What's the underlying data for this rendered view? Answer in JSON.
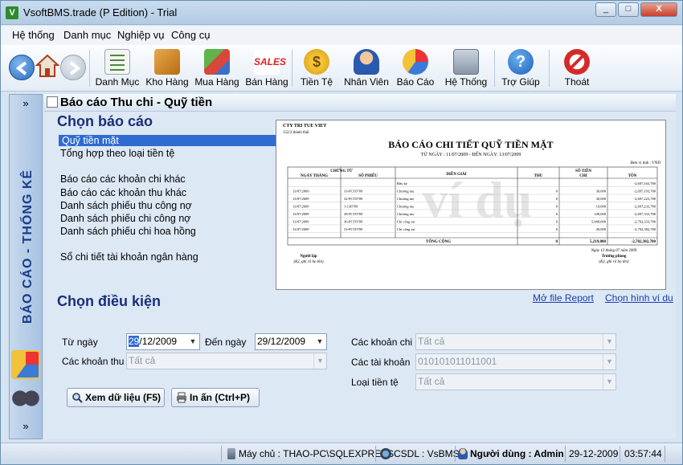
{
  "window": {
    "title": "VsoftBMS.trade (P Edition) - Trial",
    "min": "_",
    "max": "□",
    "close": "X"
  },
  "menu": [
    "Hệ thống",
    "Danh mục",
    "Nghiệp vụ",
    "Công cụ"
  ],
  "toolbar": {
    "items": [
      {
        "label": "Danh Mục",
        "icon": "list-icon"
      },
      {
        "label": "Kho Hàng",
        "icon": "box-icon"
      },
      {
        "label": "Mua Hàng",
        "icon": "purchase-icon"
      },
      {
        "label": "Bán Hàng",
        "icon": "sales-icon"
      },
      {
        "label": "Tiền Tệ",
        "icon": "money-icon"
      },
      {
        "label": "Nhân Viên",
        "icon": "person-icon"
      },
      {
        "label": "Báo Cáo",
        "icon": "chart-icon"
      },
      {
        "label": "Hệ Thống",
        "icon": "network-icon"
      },
      {
        "label": "Trợ Giúp",
        "icon": "help-icon"
      },
      {
        "label": "Thoát",
        "icon": "exit-icon"
      }
    ]
  },
  "sidebar": {
    "collapse": "»",
    "vertical_label": "BÁO CÁO - THỐNG KÊ",
    "expand": "»"
  },
  "panel": {
    "title": "Báo cáo Thu chi - Quỹ tiền"
  },
  "choose_report": {
    "heading": "Chọn báo cáo",
    "items": [
      "Quỹ tiền mặt",
      "Tổng hợp theo loại tiền tệ",
      "Báo cáo các khoản chi khác",
      "Báo cáo các khoản thu khác",
      "Danh sách phiếu thu công nợ",
      "Danh sách phiếu chi công nợ",
      "Danh sách phiếu chi hoa hồng",
      "Sổ chi tiết tài khoản ngân hàng"
    ]
  },
  "preview": {
    "company": "CTY TRI TUE VIET",
    "address": "152/2 thành thái",
    "title": "BÁO CÁO CHI TIẾT QUỸ TIỀN MẶT",
    "period": "TỪ NGÀY : 11/07/2009 - ĐẾN NGÀY: 13/07/2009",
    "unit": "Đơn vị tính : VND",
    "watermark": "ví dụ",
    "headers": {
      "voucher": "CHỨNG TỪ",
      "date": "NGÀY THÁNG",
      "no": "SỐ PHIẾU",
      "desc": "DIỄN GIẢI",
      "amount": "SỐ TIỀN",
      "thu": "THU",
      "chi": "CHI",
      "ton": "TỒN"
    },
    "rows": [
      {
        "date": "",
        "no": "",
        "desc": "Đầu kỳ",
        "thu": "",
        "chi": "",
        "ton": "-2,697,163,780"
      },
      {
        "date": "13/07/2009",
        "no": "33-PCT0709",
        "desc": "Chương mẹ",
        "thu": "0",
        "chi": "30,000",
        "ton": "-2,697,193,780"
      },
      {
        "date": "13/07/2009",
        "no": "32-PCT0709",
        "desc": "Chương mẹ",
        "thu": "0",
        "chi": "30,000",
        "ton": "-2,697,223,780"
      },
      {
        "date": "13/07/2009",
        "no": "1-130709",
        "desc": "Chương mẹ",
        "thu": "0",
        "chi": "10,000",
        "ton": "-2,697,233,780"
      },
      {
        "date": "13/07/2009",
        "no": "38-PCT0709",
        "desc": "Chương mẹ",
        "thu": "0",
        "chi": "100,000",
        "ton": "-2,697,333,780"
      },
      {
        "date": "13/07/2009",
        "no": "36-PCT0709",
        "desc": "Chi công nợ",
        "thu": "0",
        "chi": "5,000,000",
        "ton": "-2,702,333,780"
      },
      {
        "date": "13/07/2009",
        "no": "33-PCT0709",
        "desc": "Chi công nợ",
        "thu": "0",
        "chi": "49,000",
        "ton": "-2,702,382,780"
      }
    ],
    "total": {
      "label": "TỔNG CỘNG",
      "thu": "0",
      "chi": "5,219,000",
      "ton": "-2,702,382,780"
    },
    "sign_date": "Ngày 13 tháng 07 năm 2009",
    "left_sign": "Người lập",
    "left_note": "(Ký, ghi rõ họ tên)",
    "right_sign": "Trưởng phòng",
    "right_note": "(Ký, ghi rõ họ tên)"
  },
  "links": {
    "open_report": "Mở file Report",
    "choose_image": "Chọn hình ví du"
  },
  "conditions": {
    "heading": "Chọn điều kiện",
    "from_label": "Từ ngày",
    "from_day": "29",
    "from_rest": "/12/2009",
    "to_label": "Đến ngày",
    "to_value": "29/12/2009",
    "income_label": "Các khoản thu",
    "income_value": "Tất cả",
    "expense_label": "Các khoản chi",
    "expense_value": "Tất cả",
    "account_label": "Các tài khoản",
    "account_value": "010101011011001",
    "currency_label": "Loại tiền tệ",
    "currency_value": "Tất cả"
  },
  "buttons": {
    "view": "Xem dữ liệu (F5)",
    "print": "In ấn (Ctrl+P)"
  },
  "status": {
    "server": "Máy chủ : THAO-PC\\SQLEXPRESS",
    "db": "CSDL : VsBMS",
    "user": "Người dùng : Admin",
    "date": "29-12-2009",
    "time": "03:57:44"
  },
  "colors": {
    "accent": "#2f6bd0",
    "heading": "#1a2f7a",
    "vertical": "#1a3c8a"
  }
}
